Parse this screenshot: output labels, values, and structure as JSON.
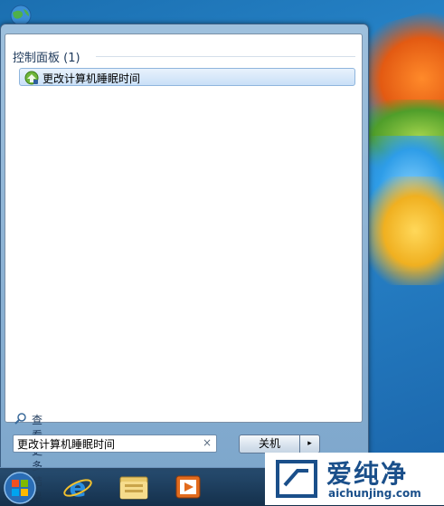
{
  "start_menu": {
    "group_header": "控制面板 (1)",
    "results": [
      {
        "label": "更改计算机睡眠时间",
        "icon": "power-options-icon"
      }
    ],
    "see_more_label": "查看更多结果",
    "search": {
      "value": "更改计算机睡眠时间",
      "clear_label": "×"
    },
    "shutdown_label": "关机",
    "shutdown_arrow": "▸"
  },
  "taskbar": {
    "items": [
      {
        "icon": "start-orb-icon"
      },
      {
        "icon": "internet-explorer-icon"
      },
      {
        "icon": "file-explorer-icon"
      },
      {
        "icon": "media-player-icon"
      }
    ]
  },
  "watermark": {
    "brand_cn": "爱纯净",
    "url": "aichunjing.com"
  },
  "colors": {
    "accent": "#1e395b",
    "selection": "#c9e0f7",
    "taskbar": "#1e3a55"
  }
}
